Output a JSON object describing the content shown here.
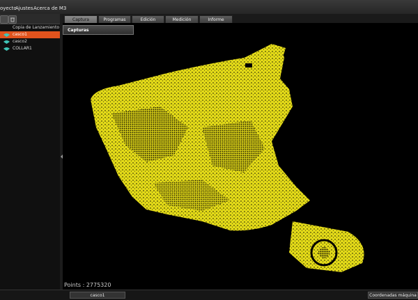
{
  "menu": [
    "oyecto",
    "Ajustes",
    "Acerca de M3"
  ],
  "tabs": [
    {
      "label": "Captura manual",
      "active": true
    },
    {
      "label": "Programas",
      "active": false
    },
    {
      "label": "Edición",
      "active": false
    },
    {
      "label": "Medición",
      "active": false
    },
    {
      "label": "Informe",
      "active": false
    }
  ],
  "tree": {
    "header": "Copia de Lanzamiento",
    "items": [
      {
        "label": "casco1",
        "selected": true
      },
      {
        "label": "casco2",
        "selected": false
      },
      {
        "label": "COLLAR1",
        "selected": false
      }
    ]
  },
  "capture_panel": {
    "label": "Capturas"
  },
  "viewport": {
    "points_label": "Points : 2775320",
    "cloud_color": "#e8e01c",
    "background": "#000000"
  },
  "status": {
    "selected_object": "casco1",
    "coords_mode": "Coordenadas máquina"
  },
  "colors": {
    "accent": "#e0531d",
    "tree_icon": "#3fc6b8"
  }
}
